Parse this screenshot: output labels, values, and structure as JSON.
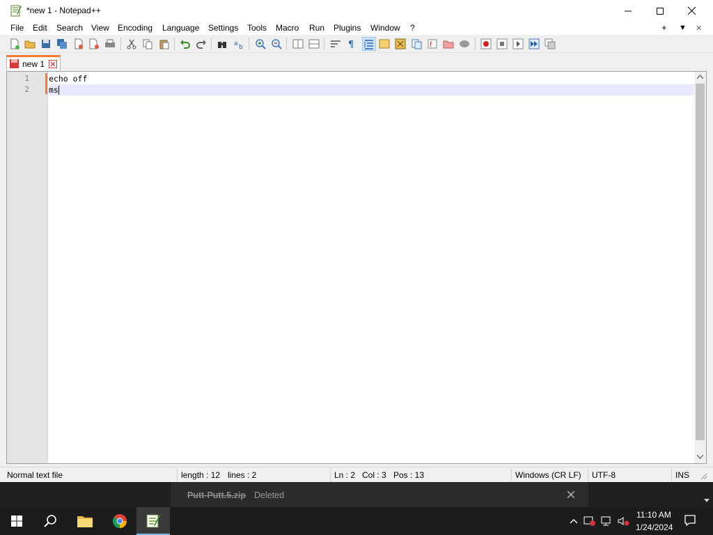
{
  "window": {
    "title": "*new 1 - Notepad++"
  },
  "menu": [
    "File",
    "Edit",
    "Search",
    "View",
    "Encoding",
    "Language",
    "Settings",
    "Tools",
    "Macro",
    "Run",
    "Plugins",
    "Window",
    "?"
  ],
  "menu_right": {
    "plus": "+",
    "down": "▼",
    "close": "✕"
  },
  "tabs": [
    {
      "label": "new 1"
    }
  ],
  "editor": {
    "lines": [
      "echo off",
      "ms"
    ],
    "line_numbers": [
      "1",
      "2"
    ]
  },
  "status": {
    "file_type": "Normal text file",
    "length": "length : 12",
    "lines": "lines : 2",
    "ln": "Ln : 2",
    "col": "Col : 3",
    "pos": "Pos : 13",
    "eol": "Windows (CR LF)",
    "encoding": "UTF-8",
    "mode": "INS"
  },
  "download": {
    "filename": "Putt-Putt.5.zip",
    "status": "Deleted"
  },
  "taskbar": {
    "time": "11:10 AM",
    "date": "1/24/2024"
  },
  "colors": {
    "accent": "#fa7b30",
    "current_line": "#e8e8ff",
    "taskbar": "#1c1c1c"
  }
}
